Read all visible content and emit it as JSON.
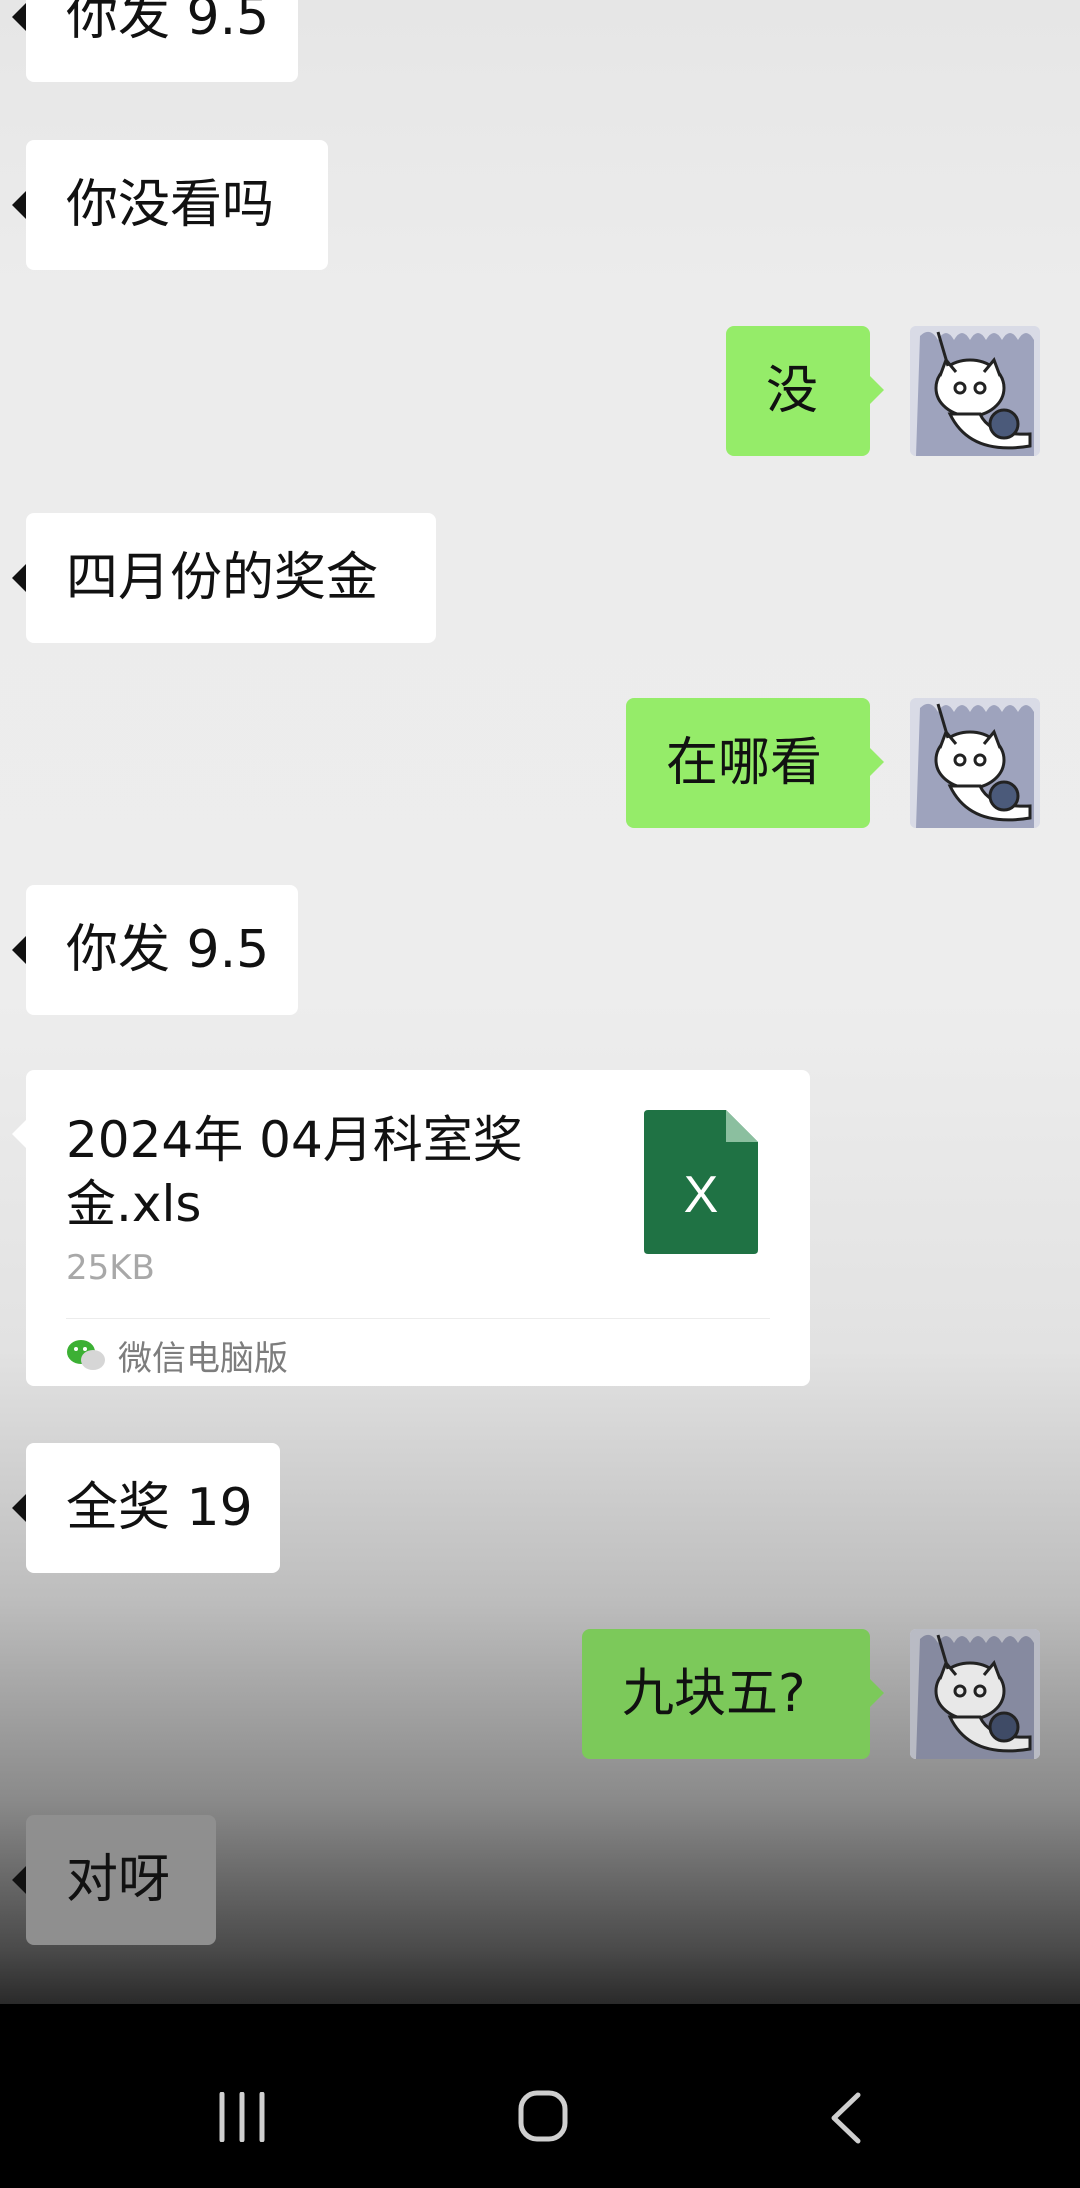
{
  "messages": {
    "m0": "你发 9.5",
    "m1": "你没看吗",
    "m2": "没",
    "m3": "四月份的奖金",
    "m4": "在哪看",
    "m5": "你发 9.5",
    "m7": "全奖 19",
    "m8": "九块五?",
    "m9": "对呀"
  },
  "file": {
    "name": "2024年 04月科室奖金.xls",
    "size": "25KB",
    "source": "微信电脑版",
    "icon_letter": "X",
    "icon_color": "#1f7244"
  },
  "colors": {
    "incoming_bubble": "#ffffff",
    "outgoing_bubble": "#95ec69",
    "chat_background": "#ededed"
  },
  "navbar": {
    "icons": [
      "recent-apps-icon",
      "home-icon",
      "back-icon"
    ]
  }
}
